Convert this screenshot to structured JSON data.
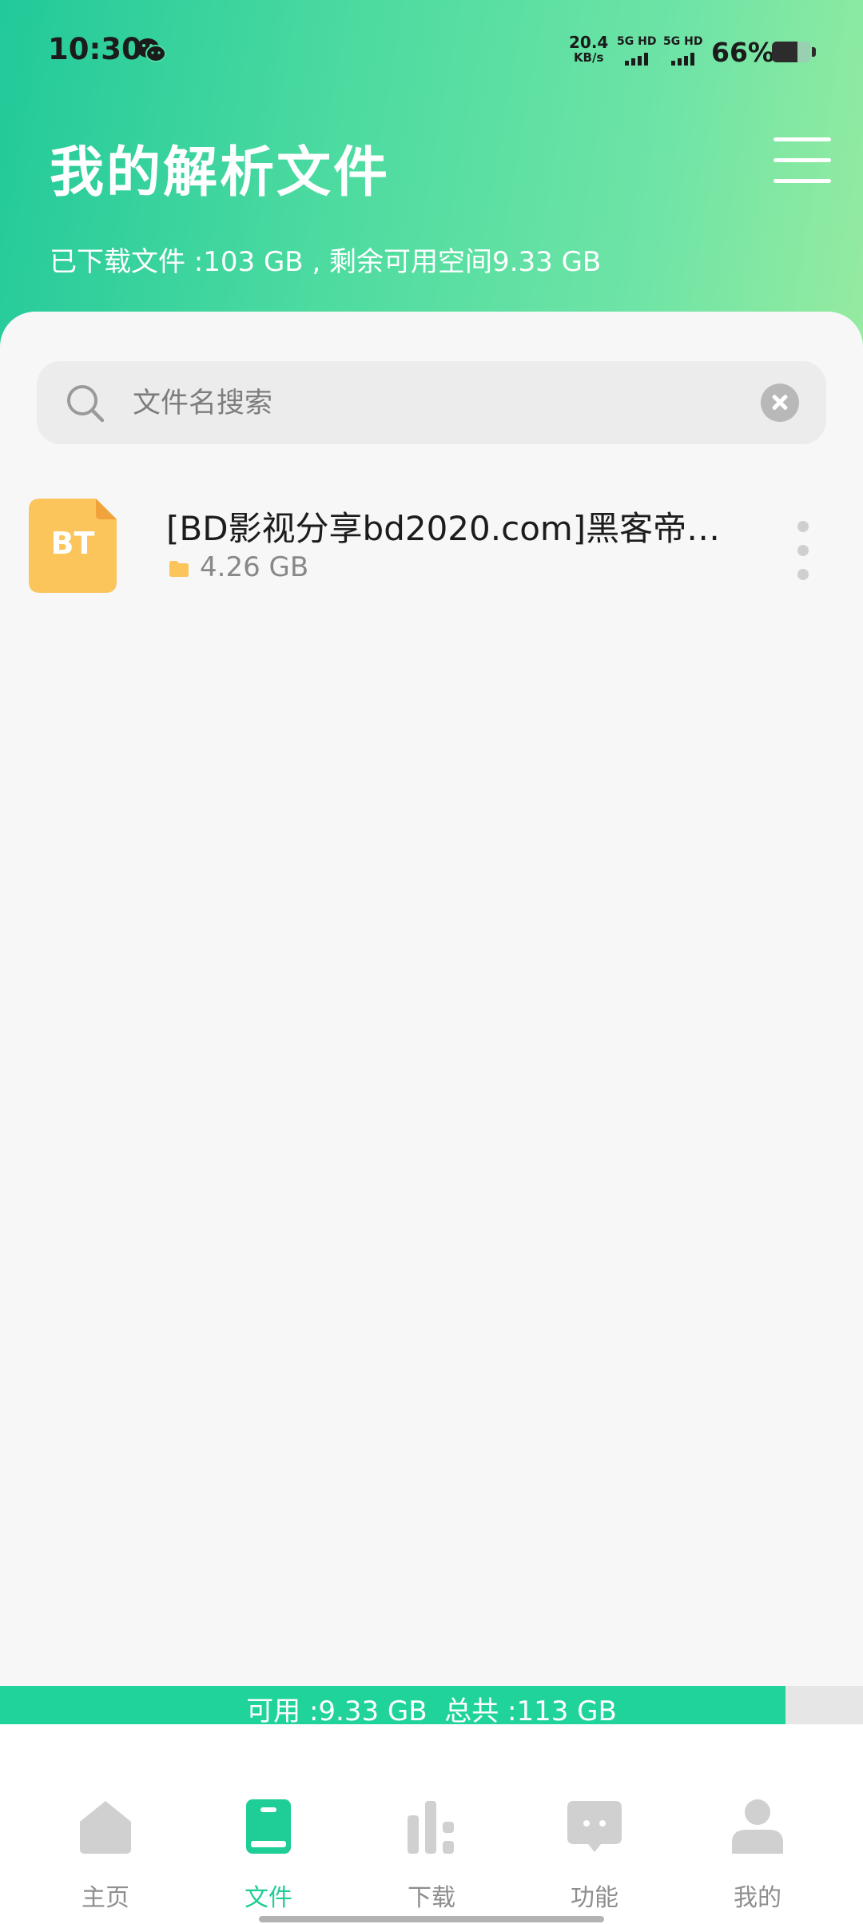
{
  "status_bar": {
    "time": "10:30",
    "net_speed_value": "20.4",
    "net_speed_unit": "KB/s",
    "sim1_label": "5G HD",
    "sim2_label": "5G HD",
    "battery_percent": "66%",
    "battery_level": 0.66
  },
  "header": {
    "title": "我的解析文件",
    "storage_summary": "已下载文件 :103 GB , 剩余可用空间9.33 GB"
  },
  "search": {
    "placeholder": "文件名搜索",
    "value": ""
  },
  "files": [
    {
      "type_label": "BT",
      "name": "[BD影视分享bd2020.com]黑客帝…",
      "size": "4.26 GB"
    }
  ],
  "storage_bar": {
    "text": "可用 :9.33 GB  总共 :113 GB",
    "fill_fraction": 0.91
  },
  "nav": {
    "items": [
      {
        "label": "主页",
        "icon": "home-icon",
        "active": false
      },
      {
        "label": "文件",
        "icon": "file-book-icon",
        "active": true
      },
      {
        "label": "下载",
        "icon": "download-bars-icon",
        "active": false
      },
      {
        "label": "功能",
        "icon": "chat-function-icon",
        "active": false
      },
      {
        "label": "我的",
        "icon": "user-icon",
        "active": false
      }
    ]
  },
  "colors": {
    "accent": "#1fcd96",
    "header_gradient_start": "#22c99a",
    "header_gradient_end": "#96eba0",
    "file_icon": "#fbc55c",
    "nav_inactive": "#d0d0d0"
  }
}
